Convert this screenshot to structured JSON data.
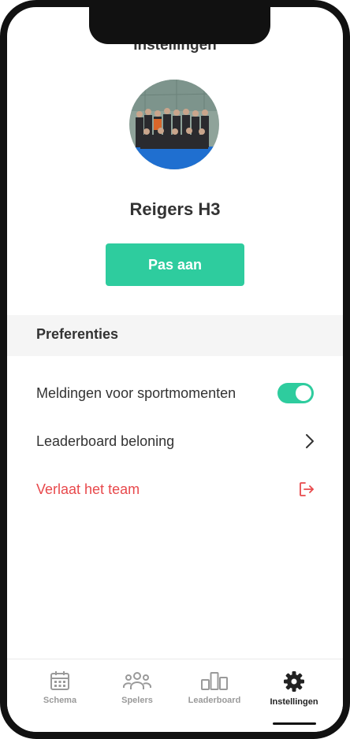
{
  "header": {
    "title": "Instellingen"
  },
  "team": {
    "name": "Reigers H3",
    "edit_label": "Pas aan"
  },
  "preferences": {
    "section_title": "Preferenties",
    "notifications": {
      "label": "Meldingen voor sportmomenten",
      "enabled": true
    },
    "leaderboard": {
      "label": "Leaderboard beloning"
    },
    "leave": {
      "label": "Verlaat het team"
    }
  },
  "tabs": [
    {
      "label": "Schema",
      "icon": "calendar-icon"
    },
    {
      "label": "Spelers",
      "icon": "people-icon"
    },
    {
      "label": "Leaderboard",
      "icon": "podium-icon"
    },
    {
      "label": "Instellingen",
      "icon": "gear-icon",
      "active": true
    }
  ],
  "colors": {
    "accent": "#2ecc9e",
    "danger": "#e8494c",
    "text": "#333333"
  }
}
